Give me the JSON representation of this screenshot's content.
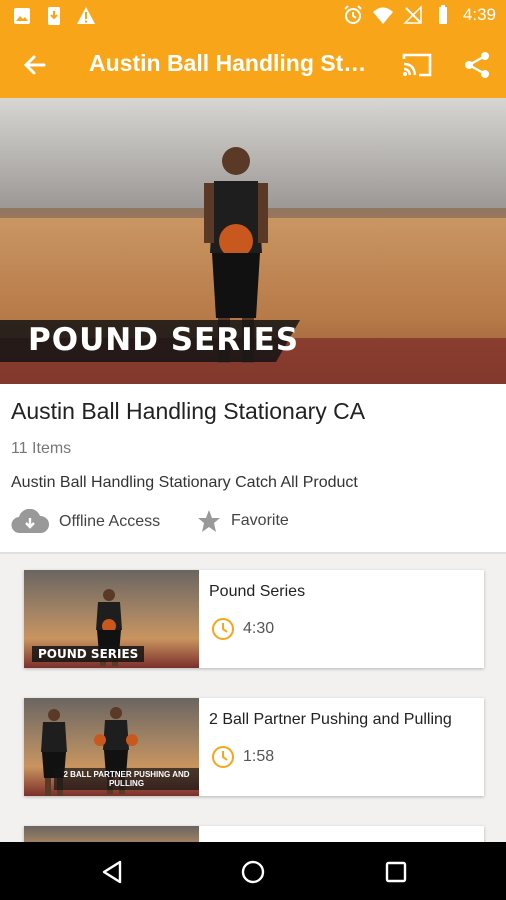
{
  "status_bar": {
    "time": "4:39",
    "left_icons": [
      "image-icon",
      "download-icon",
      "warning-icon"
    ],
    "right_icons": [
      "alarm-icon",
      "wifi-icon",
      "no-signal-icon",
      "battery-icon"
    ]
  },
  "app_bar": {
    "title": "Austin Ball Handling Sta…",
    "back_icon": "arrow-back-icon",
    "cast_icon": "cast-icon",
    "share_icon": "share-icon"
  },
  "hero": {
    "banner_text": "POUND SERIES"
  },
  "collection": {
    "name": "Austin Ball Handling Stationary CA",
    "item_count": "11 Items",
    "description": "Austin Ball Handling Stationary Catch All Product",
    "offline_label": "Offline Access",
    "favorite_label": "Favorite"
  },
  "videos": [
    {
      "title": "Pound Series",
      "duration": "4:30",
      "thumb_caption": "POUND SERIES"
    },
    {
      "title": "2 Ball Partner Pushing and Pulling",
      "duration": "1:58",
      "thumb_caption": "2 BALL PARTNER PUSHING AND PULLING"
    }
  ],
  "colors": {
    "accent": "#f9a51a",
    "clock_icon": "#f9a51a"
  }
}
